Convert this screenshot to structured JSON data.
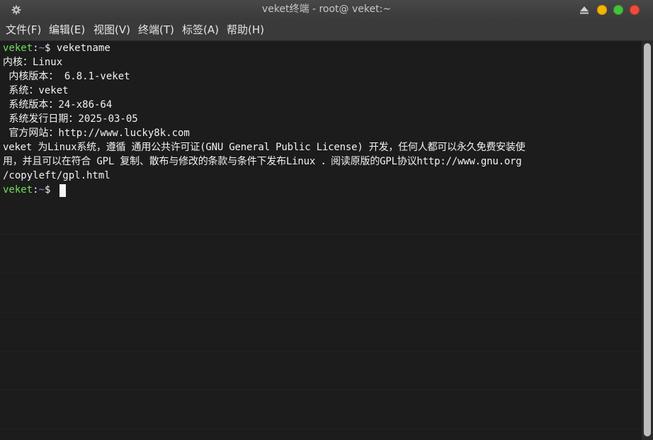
{
  "window": {
    "title": "veket终端 - root@ veket:~",
    "icons": [
      "gear-icon",
      "eject-icon"
    ],
    "buttons": {
      "minimize_color": "#f5b400",
      "maximize_color": "#45c23c",
      "close_color": "#ef4b3b"
    }
  },
  "menubar": {
    "items": [
      {
        "label": "文件(F)"
      },
      {
        "label": "编辑(E)"
      },
      {
        "label": "视图(V)"
      },
      {
        "label": "终端(T)"
      },
      {
        "label": "标签(A)"
      },
      {
        "label": "帮助(H)"
      }
    ]
  },
  "terminal": {
    "prompt": {
      "user": "veket",
      "sep": ":",
      "dir": "~",
      "symbol": "$ "
    },
    "command": "veketname",
    "output": [
      "内核：Linux",
      " 内核版本： 6.8.1-veket",
      " 系统：veket",
      " 系统版本：24-x86-64",
      " 系统发行日期：2025-03-05",
      " 官方网站：http://www.lucky8k.com",
      "veket 为Linux系统，遵循 通用公共许可证(GNU General Public License) 开发，任何人都可以永久免费安装使",
      "用，并且可以在符合 GPL 复制、散布与修改的条款与条件下发布Linux ．阅读原版的GPL协议http://www.gnu.org",
      "/copyleft/gpl.html"
    ],
    "colors": {
      "background": "#1c1c1c",
      "foreground": "#f2f2f2",
      "prompt_user": "#6fe05a",
      "prompt_dir": "#6f8fe8"
    }
  }
}
